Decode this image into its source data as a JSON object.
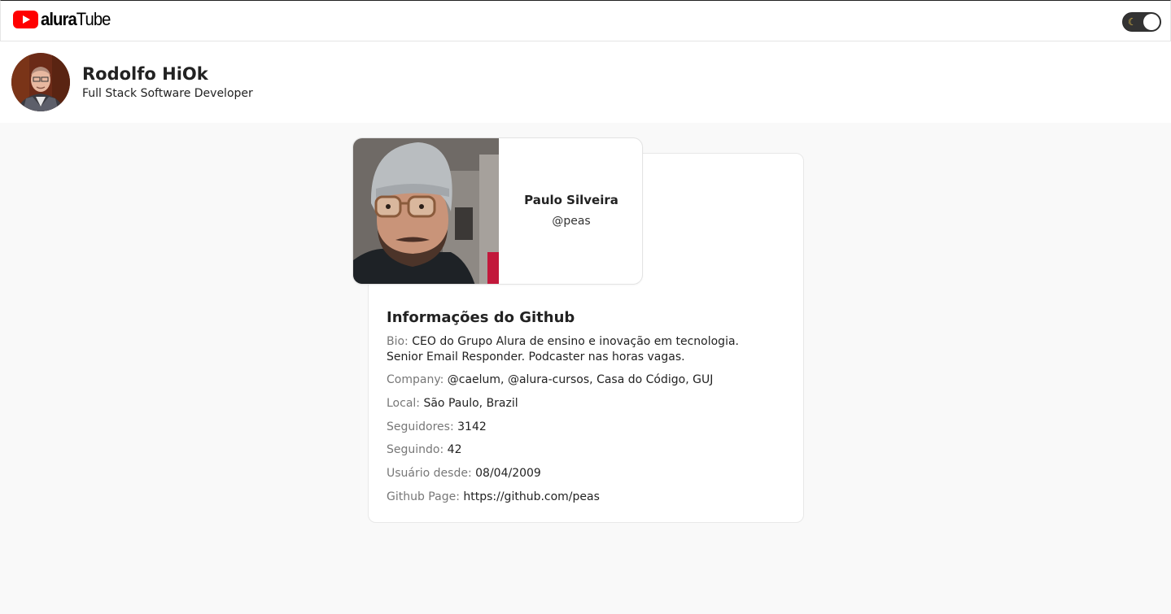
{
  "app": {
    "logo_bold": "alura",
    "logo_light": "Tube",
    "brand_color": "#ff0000",
    "theme_toggle_icon": "moon-icon"
  },
  "user": {
    "name": "Rodolfo HiOk",
    "role": "Full Stack Software Developer"
  },
  "profile": {
    "name": "Paulo Silveira",
    "login": "@peas"
  },
  "github_info": {
    "title": "Informações do Github",
    "fields": [
      {
        "label": "Bio:",
        "value": "CEO do Grupo Alura de ensino e inovação em tecnologia. Senior Email Responder. Podcaster nas horas vagas."
      },
      {
        "label": "Company:",
        "value": "@caelum, @alura-cursos, Casa do Código, GUJ"
      },
      {
        "label": "Local:",
        "value": "São Paulo, Brazil"
      },
      {
        "label": "Seguidores:",
        "value": "3142"
      },
      {
        "label": "Seguindo:",
        "value": "42"
      },
      {
        "label": "Usuário desde:",
        "value": "08/04/2009"
      },
      {
        "label": "Github Page:",
        "value": "https://github.com/peas"
      }
    ]
  }
}
